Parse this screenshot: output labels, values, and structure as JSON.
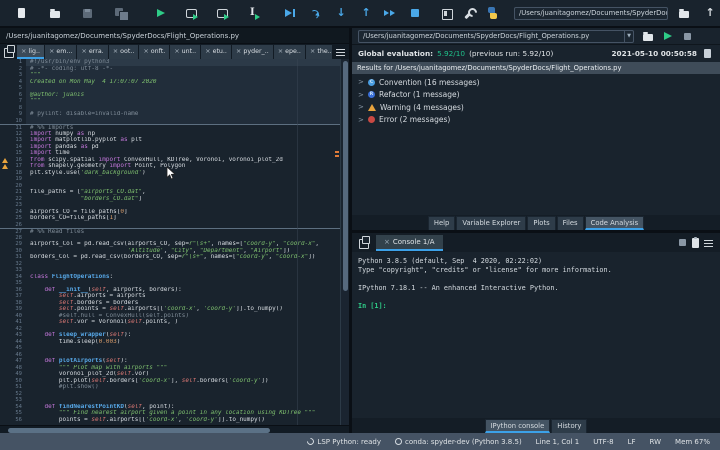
{
  "colors": {
    "accent": "#3ca1e8",
    "score_green": "#1fbf89",
    "warning_orange": "#e8a33d",
    "error_red": "#c94943",
    "convention_blue": "#4a9de0",
    "refactor_blue": "#3a6fd8",
    "run_green": "#2ecc87",
    "debug_blue": "#4aa8e8",
    "keyword_purple": "#c678dd",
    "string_green": "#7fc16f",
    "comment_grey": "#7f8c98"
  },
  "toolbar": {
    "groups": [
      [
        "new-file",
        "open-file",
        "save",
        "save-all"
      ],
      [
        "run",
        "run-cell",
        "run-cell-advance",
        "run-selection"
      ],
      [
        "debug",
        "step-over",
        "step-into",
        "step-out",
        "continue",
        "stop"
      ],
      [
        "maximize-pane",
        "preferences",
        "python"
      ]
    ],
    "cwd_path": "/Users/juanitagomez/Documents/SpyderDocs"
  },
  "editor": {
    "path": "/Users/juanitagomez/Documents/SpyderDocs/Flight_Operations.py",
    "active_tab": 0,
    "tabs": [
      "lig..",
      "em...",
      "erra.",
      "oot..",
      "onft.",
      "unt..",
      "etu..",
      "pyder_..",
      "epe..",
      "the.."
    ],
    "lines": [
      {
        "n": 1,
        "f": "cellbg cur",
        "t": [
          [
            "c",
            "#!/usr/bin/env python3"
          ]
        ]
      },
      {
        "n": 2,
        "f": "cellbg",
        "t": [
          [
            "c",
            "# -*- coding: utf-8 -*-"
          ]
        ]
      },
      {
        "n": 3,
        "f": "cellbg",
        "t": [
          [
            "s",
            "\"\"\""
          ]
        ]
      },
      {
        "n": 4,
        "f": "cellbg",
        "t": [
          [
            "s",
            "Created on Mon May  4 17:07:07 2020"
          ]
        ]
      },
      {
        "n": 5,
        "f": "cellbg",
        "t": []
      },
      {
        "n": 6,
        "f": "cellbg",
        "t": [
          [
            "s",
            "@author: juanis"
          ]
        ]
      },
      {
        "n": 7,
        "f": "cellbg",
        "t": [
          [
            "s",
            "\"\"\""
          ]
        ]
      },
      {
        "n": 8,
        "f": "cellbg",
        "t": []
      },
      {
        "n": 9,
        "f": "cellbg",
        "t": [
          [
            "c",
            "# pylint: disable=invalid-name"
          ]
        ]
      },
      {
        "n": 10,
        "f": "cellbg",
        "t": []
      },
      {
        "n": 11,
        "f": "cellsep",
        "t": [
          [
            "c",
            "# %% Imports"
          ]
        ]
      },
      {
        "n": 12,
        "t": [
          [
            "k",
            "import"
          ],
          [
            "p",
            " numpy "
          ],
          [
            "k",
            "as"
          ],
          [
            "p",
            " np"
          ]
        ]
      },
      {
        "n": 13,
        "t": [
          [
            "k",
            "import"
          ],
          [
            "p",
            " matplotlib.pyplot "
          ],
          [
            "k",
            "as"
          ],
          [
            "p",
            " plt"
          ]
        ]
      },
      {
        "n": 14,
        "t": [
          [
            "k",
            "import"
          ],
          [
            "p",
            " pandas "
          ],
          [
            "k",
            "as"
          ],
          [
            "p",
            " pd"
          ]
        ]
      },
      {
        "n": 15,
        "t": [
          [
            "k",
            "import"
          ],
          [
            "p",
            " time"
          ]
        ]
      },
      {
        "n": 16,
        "w": 1,
        "t": [
          [
            "k",
            "from"
          ],
          [
            "p",
            " scipy.spatial "
          ],
          [
            "k",
            "import"
          ],
          [
            "p",
            " ConvexHull, KDTree, Voronoi, voronoi_plot_2d"
          ]
        ]
      },
      {
        "n": 17,
        "w": 1,
        "t": [
          [
            "k",
            "from"
          ],
          [
            "p",
            " shapely.geometry "
          ],
          [
            "k",
            "import"
          ],
          [
            "p",
            " Point, Polygon"
          ]
        ]
      },
      {
        "n": 18,
        "t": [
          [
            "p",
            "plt.style.use("
          ],
          [
            "s",
            "'dark_background'"
          ],
          [
            "p",
            ")"
          ]
        ]
      },
      {
        "n": 19,
        "t": []
      },
      {
        "n": 20,
        "t": []
      },
      {
        "n": 21,
        "t": [
          [
            "p",
            "file_paths = ["
          ],
          [
            "s",
            "\"airports_CO.dat\""
          ],
          [
            "p",
            ","
          ]
        ]
      },
      {
        "n": 22,
        "t": [
          [
            "p",
            "              "
          ],
          [
            "s",
            "\"borders_CO.dat\""
          ],
          [
            "p",
            "]"
          ]
        ]
      },
      {
        "n": 23,
        "t": []
      },
      {
        "n": 24,
        "t": [
          [
            "p",
            "airports_CO = file_paths["
          ],
          [
            "n2",
            "0"
          ],
          [
            "p",
            "]"
          ]
        ]
      },
      {
        "n": 25,
        "t": [
          [
            "p",
            "borders_CO=file_paths["
          ],
          [
            "n2",
            "1"
          ],
          [
            "p",
            "]"
          ]
        ]
      },
      {
        "n": 26,
        "t": []
      },
      {
        "n": 27,
        "f": "cellsep",
        "t": [
          [
            "c",
            "# %% Read files"
          ]
        ]
      },
      {
        "n": 28,
        "t": []
      },
      {
        "n": 29,
        "t": [
          [
            "p",
            "airports_Col = pd.read_csv(airports_CO, sep="
          ],
          [
            "s",
            "r\"\\s+\""
          ],
          [
            "p",
            ", names=["
          ],
          [
            "s",
            "\"coord-y\""
          ],
          [
            "p",
            ", "
          ],
          [
            "s",
            "\"coord-x\""
          ],
          [
            "p",
            ","
          ]
        ]
      },
      {
        "n": 30,
        "t": [
          [
            "p",
            "                           "
          ],
          [
            "s",
            "'Altitude'"
          ],
          [
            "p",
            ", "
          ],
          [
            "s",
            "\"City\""
          ],
          [
            "p",
            ", "
          ],
          [
            "s",
            "\"Department\""
          ],
          [
            "p",
            ", "
          ],
          [
            "s",
            "\"Airport\""
          ],
          [
            "p",
            "])"
          ]
        ]
      },
      {
        "n": 31,
        "t": [
          [
            "p",
            "borders_Col = pd.read_csv(borders_CO, sep="
          ],
          [
            "s",
            "r\"\\s+\""
          ],
          [
            "p",
            ", names=["
          ],
          [
            "s",
            "\"coord-y\""
          ],
          [
            "p",
            ", "
          ],
          [
            "s",
            "\"coord-x\""
          ],
          [
            "p",
            "])"
          ]
        ]
      },
      {
        "n": 32,
        "t": []
      },
      {
        "n": 33,
        "t": []
      },
      {
        "n": 34,
        "t": [
          [
            "k",
            "class"
          ],
          [
            "p",
            " "
          ],
          [
            "d",
            "FlightOperations"
          ],
          [
            "p",
            ":"
          ]
        ]
      },
      {
        "n": 35,
        "t": []
      },
      {
        "n": 36,
        "t": [
          [
            "p",
            "    "
          ],
          [
            "k",
            "def"
          ],
          [
            "p",
            " "
          ],
          [
            "d",
            "__init__"
          ],
          [
            "p",
            "("
          ],
          [
            "b",
            "self"
          ],
          [
            "p",
            ", airports, borders):"
          ]
        ]
      },
      {
        "n": 37,
        "t": [
          [
            "p",
            "        "
          ],
          [
            "b",
            "self"
          ],
          [
            "p",
            ".airports = airports"
          ]
        ]
      },
      {
        "n": 38,
        "t": [
          [
            "p",
            "        "
          ],
          [
            "b",
            "self"
          ],
          [
            "p",
            ".borders = borders"
          ]
        ]
      },
      {
        "n": 39,
        "t": [
          [
            "p",
            "        "
          ],
          [
            "b",
            "self"
          ],
          [
            "p",
            ".points = "
          ],
          [
            "b",
            "self"
          ],
          [
            "p",
            ".airports[["
          ],
          [
            "s",
            "'coord-x'"
          ],
          [
            "p",
            ", "
          ],
          [
            "s",
            "'coord-y'"
          ],
          [
            "p",
            "]].to_numpy()"
          ]
        ]
      },
      {
        "n": 40,
        "t": [
          [
            "c",
            "        #self.hull = ConvexHull(self.points)"
          ]
        ]
      },
      {
        "n": 41,
        "t": [
          [
            "p",
            "        "
          ],
          [
            "b",
            "self"
          ],
          [
            "p",
            ".vor = Voronoi("
          ],
          [
            "b",
            "self"
          ],
          [
            "p",
            ".points, )"
          ]
        ]
      },
      {
        "n": 42,
        "t": []
      },
      {
        "n": 43,
        "t": [
          [
            "p",
            "    "
          ],
          [
            "k",
            "def"
          ],
          [
            "p",
            " "
          ],
          [
            "d",
            "sleep_wrapper"
          ],
          [
            "p",
            "("
          ],
          [
            "b",
            "self"
          ],
          [
            "p",
            "):"
          ]
        ]
      },
      {
        "n": 44,
        "t": [
          [
            "p",
            "        time.sleep("
          ],
          [
            "n2",
            "0.003"
          ],
          [
            "p",
            ")"
          ]
        ]
      },
      {
        "n": 45,
        "t": []
      },
      {
        "n": 46,
        "t": []
      },
      {
        "n": 47,
        "t": [
          [
            "p",
            "    "
          ],
          [
            "k",
            "def"
          ],
          [
            "p",
            " "
          ],
          [
            "d",
            "plotAirports"
          ],
          [
            "p",
            "("
          ],
          [
            "b",
            "self"
          ],
          [
            "p",
            "):"
          ]
        ]
      },
      {
        "n": 48,
        "t": [
          [
            "p",
            "        "
          ],
          [
            "s",
            "\"\"\" Plot map with airports \"\"\""
          ]
        ]
      },
      {
        "n": 49,
        "t": [
          [
            "p",
            "        voronoi_plot_2d("
          ],
          [
            "b",
            "self"
          ],
          [
            "p",
            ".vor)"
          ]
        ]
      },
      {
        "n": 50,
        "t": [
          [
            "p",
            "        plt.plot("
          ],
          [
            "b",
            "self"
          ],
          [
            "p",
            ".borders["
          ],
          [
            "s",
            "'coord-x'"
          ],
          [
            "p",
            "], "
          ],
          [
            "b",
            "self"
          ],
          [
            "p",
            ".borders["
          ],
          [
            "s",
            "'coord-y'"
          ],
          [
            "p",
            "])"
          ]
        ]
      },
      {
        "n": 51,
        "t": [
          [
            "c",
            "        #plt.show()"
          ]
        ]
      },
      {
        "n": 52,
        "t": []
      },
      {
        "n": 53,
        "t": []
      },
      {
        "n": 54,
        "t": [
          [
            "p",
            "    "
          ],
          [
            "k",
            "def"
          ],
          [
            "p",
            " "
          ],
          [
            "d",
            "findNearestPointKD"
          ],
          [
            "p",
            "("
          ],
          [
            "b",
            "self"
          ],
          [
            "p",
            ", point):"
          ]
        ]
      },
      {
        "n": 55,
        "t": [
          [
            "p",
            "        "
          ],
          [
            "s",
            "\"\"\" Find nearest airport given a point in any location using KDTree \"\"\""
          ]
        ]
      },
      {
        "n": 56,
        "t": [
          [
            "p",
            "        points = "
          ],
          [
            "b",
            "self"
          ],
          [
            "p",
            ".airports[["
          ],
          [
            "s",
            "'coord-x'"
          ],
          [
            "p",
            ", "
          ],
          [
            "s",
            "'coord-y'"
          ],
          [
            "p",
            "]].to_numpy()"
          ]
        ]
      }
    ]
  },
  "analysis": {
    "path": "/Users/juanitagomez/Documents/SpyderDocs/Flight_Operations.py",
    "global_eval_label": "Global evaluation:",
    "score": "5.92/10",
    "previous": "(previous run: 5.92/10)",
    "datetime": "2021-05-10 00:50:58",
    "results_header": "Results for /Users/juanitagomez/Documents/SpyderDocs/Flight_Operations.py",
    "items": [
      {
        "kind": "convention",
        "letter": "C",
        "color": "#4a9de0",
        "label": "Convention (16 messages)"
      },
      {
        "kind": "refactor",
        "letter": "R",
        "color": "#3a6fd8",
        "label": "Refactor (1 message)"
      },
      {
        "kind": "warning",
        "label": "Warning (4 messages)"
      },
      {
        "kind": "error",
        "letter": "",
        "color": "#c94943",
        "label": "Error (2 messages)"
      }
    ],
    "tabs": [
      "Help",
      "Variable Explorer",
      "Plots",
      "Files",
      "Code Analysis"
    ],
    "active_tab": "Code Analysis"
  },
  "console": {
    "tab": "Console 1/A",
    "banner": [
      "Python 3.8.5 (default, Sep  4 2020, 02:22:02)",
      "Type \"copyright\", \"credits\" or \"license\" for more information.",
      "",
      "IPython 7.18.1 -- An enhanced Interactive Python."
    ],
    "prompt": "In [1]:",
    "tabs": [
      "IPython console",
      "History"
    ],
    "active_tab": "IPython console"
  },
  "statusbar": {
    "items": [
      {
        "icon": "lsp",
        "text": "LSP Python: ready"
      },
      {
        "icon": "conda",
        "text": "conda: spyder-dev (Python 3.8.5)"
      },
      {
        "text": "Line 1, Col 1"
      },
      {
        "text": "UTF-8"
      },
      {
        "text": "LF"
      },
      {
        "text": "RW"
      },
      {
        "text": "Mem 67%"
      }
    ]
  }
}
